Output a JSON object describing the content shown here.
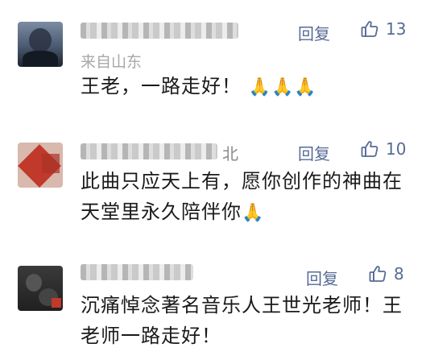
{
  "comments": [
    {
      "name_visible": "",
      "region": "来自山东",
      "reply_label": "回复",
      "likes": "13",
      "text": "王老，一路走好！",
      "emoji": "🙏🙏🙏"
    },
    {
      "name_visible": "北",
      "region": "",
      "reply_label": "回复",
      "likes": "10",
      "text": "此曲只应天上有，愿你创作的神曲在天堂里永久陪伴你",
      "emoji": "🙏"
    },
    {
      "name_visible": "",
      "region": "",
      "reply_label": "回复",
      "likes": "8",
      "text": "沉痛悼念著名音乐人王世光老师！王老师一路走好！",
      "emoji": ""
    }
  ],
  "icons": {
    "like": "thumbs-up-icon"
  },
  "colors": {
    "accent": "#576b95",
    "text": "#1a1a1a",
    "muted": "#a8a8a8"
  }
}
